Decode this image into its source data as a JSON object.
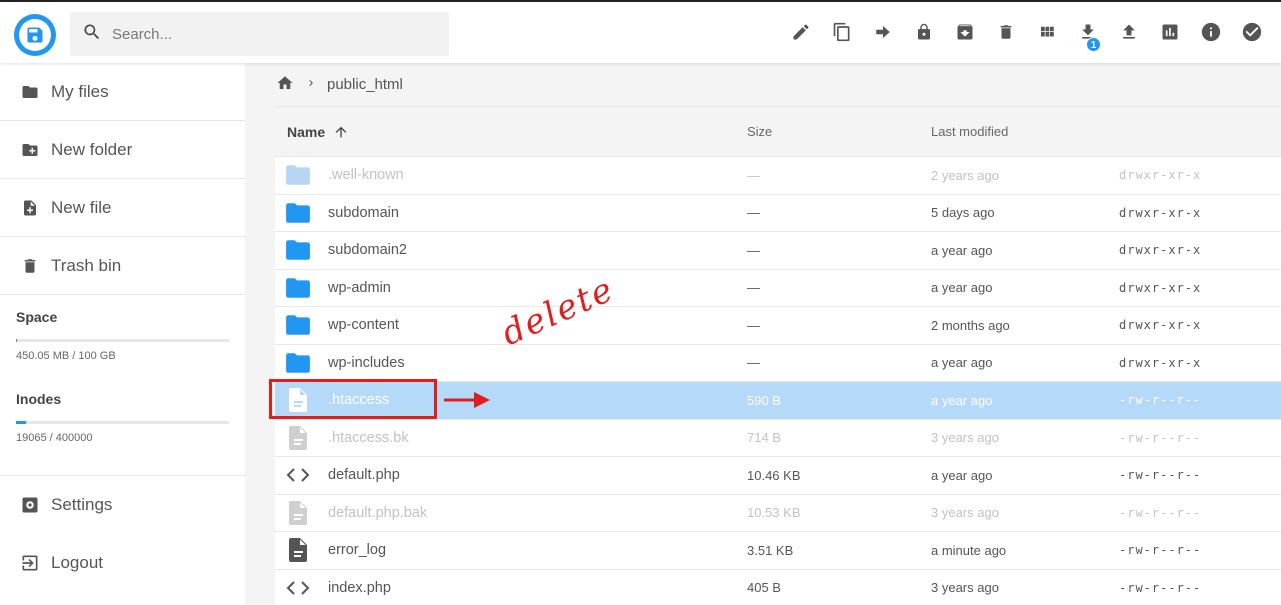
{
  "header": {
    "search_placeholder": "Search...",
    "toolbar": [
      {
        "icon": "pencil-icon",
        "name": "rename-button"
      },
      {
        "icon": "copy-icon",
        "name": "copy-button"
      },
      {
        "icon": "arrow-right-icon",
        "name": "move-button"
      },
      {
        "icon": "lock-icon",
        "name": "permissions-button"
      },
      {
        "icon": "archive-icon",
        "name": "archive-button"
      },
      {
        "icon": "trash-icon",
        "name": "delete-button"
      },
      {
        "icon": "grid-icon",
        "name": "view-mode-button"
      },
      {
        "icon": "download-icon",
        "name": "download-button",
        "badge": "1"
      },
      {
        "icon": "upload-icon",
        "name": "upload-button"
      },
      {
        "icon": "chart-icon",
        "name": "usage-button"
      },
      {
        "icon": "info-icon",
        "name": "info-button"
      },
      {
        "icon": "check-circle-icon",
        "name": "select-button"
      }
    ]
  },
  "sidebar": {
    "items": [
      {
        "label": "My files",
        "icon": "folder-icon"
      },
      {
        "label": "New folder",
        "icon": "folder-plus-icon"
      },
      {
        "label": "New file",
        "icon": "file-plus-icon"
      },
      {
        "label": "Trash bin",
        "icon": "trash-icon"
      }
    ],
    "space": {
      "title": "Space",
      "text": "450.05 MB / 100 GB",
      "fraction": 0.0045
    },
    "inodes": {
      "title": "Inodes",
      "text": "19065 / 400000",
      "fraction": 0.048
    },
    "bottom": [
      {
        "label": "Settings",
        "icon": "settings-icon"
      },
      {
        "label": "Logout",
        "icon": "logout-icon"
      }
    ]
  },
  "breadcrumb": {
    "current": "public_html"
  },
  "table": {
    "headers": {
      "name": "Name",
      "size": "Size",
      "modified": "Last modified"
    },
    "rows": [
      {
        "name": ".well-known",
        "size": "—",
        "modified": "2 years ago",
        "perm": "drwxr-xr-x",
        "type": "folder",
        "state": "dim"
      },
      {
        "name": "subdomain",
        "size": "—",
        "modified": "5 days ago",
        "perm": "drwxr-xr-x",
        "type": "folder",
        "state": "normal"
      },
      {
        "name": "subdomain2",
        "size": "—",
        "modified": "a year ago",
        "perm": "drwxr-xr-x",
        "type": "folder",
        "state": "normal"
      },
      {
        "name": "wp-admin",
        "size": "—",
        "modified": "a year ago",
        "perm": "drwxr-xr-x",
        "type": "folder",
        "state": "normal"
      },
      {
        "name": "wp-content",
        "size": "—",
        "modified": "2 months ago",
        "perm": "drwxr-xr-x",
        "type": "folder",
        "state": "normal"
      },
      {
        "name": "wp-includes",
        "size": "—",
        "modified": "a year ago",
        "perm": "drwxr-xr-x",
        "type": "folder",
        "state": "normal"
      },
      {
        "name": ".htaccess",
        "size": "590 B",
        "modified": "a year ago",
        "perm": "-rw-r--r--",
        "type": "file",
        "state": "selected"
      },
      {
        "name": ".htaccess.bk",
        "size": "714 B",
        "modified": "3 years ago",
        "perm": "-rw-r--r--",
        "type": "file",
        "state": "dim"
      },
      {
        "name": "default.php",
        "size": "10.46 KB",
        "modified": "a year ago",
        "perm": "-rw-r--r--",
        "type": "code",
        "state": "normal"
      },
      {
        "name": "default.php.bak",
        "size": "10.53 KB",
        "modified": "3 years ago",
        "perm": "-rw-r--r--",
        "type": "file",
        "state": "dim"
      },
      {
        "name": "error_log",
        "size": "3.51 KB",
        "modified": "a minute ago",
        "perm": "-rw-r--r--",
        "type": "text",
        "state": "normal"
      },
      {
        "name": "index.php",
        "size": "405 B",
        "modified": "3 years ago",
        "perm": "-rw-r--r--",
        "type": "code",
        "state": "normal"
      }
    ]
  },
  "annotation": {
    "text": "delete",
    "color": "#e01e1e"
  },
  "colors": {
    "accent": "#2196f3",
    "folder": "#2196f3",
    "selected_row": "#b5d9f8",
    "annotation": "#e01e1e"
  }
}
